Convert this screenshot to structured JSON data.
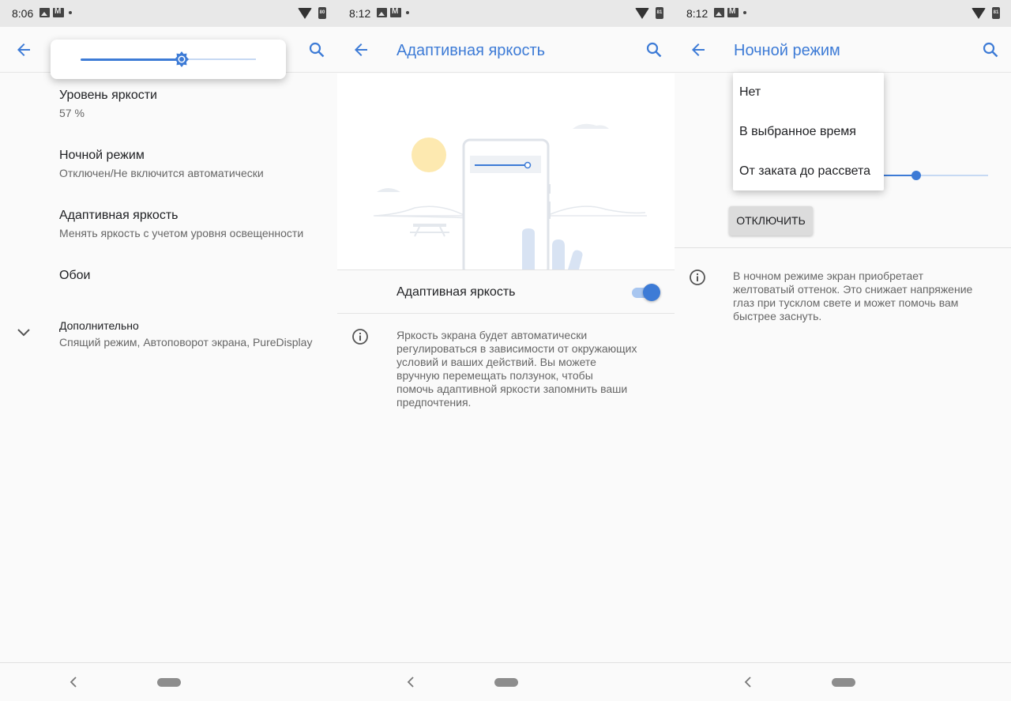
{
  "screen1": {
    "status": {
      "time": "8:06",
      "battery": "80"
    },
    "brightness_popup": {
      "level": 0.57
    },
    "items": [
      {
        "title": "Уровень яркости",
        "subtitle": "57 %"
      },
      {
        "title": "Ночной режим",
        "subtitle": "Отключен/Не включится автоматически"
      },
      {
        "title": "Адаптивная яркость",
        "subtitle": "Менять яркость с учетом уровня освещенности"
      },
      {
        "title": "Обои",
        "subtitle": ""
      },
      {
        "title": "Дополнительно",
        "subtitle": "Спящий режим, Автоповорот экрана, PureDisplay"
      }
    ]
  },
  "screen2": {
    "status": {
      "time": "8:12",
      "battery": "81"
    },
    "title": "Адаптивная яркость",
    "toggle_label": "Адаптивная яркость",
    "toggle_on": true,
    "info": "Яркость экрана будет автоматически регулироваться в зависимости от окружающих условий и ваших действий. Вы можете вручную перемещать ползунок, чтобы помочь адаптивной яркости запомнить ваши предпочтения.",
    "info_lines": [
      "Яркость экрана будет автоматически",
      "регулироваться в зависимости от окружающих",
      "условий и ваших действий. Вы можете",
      "вручную перемещать ползунок, чтобы",
      "помочь адаптивной яркости запомнить ваши",
      "предпочтения."
    ]
  },
  "screen3": {
    "status": {
      "time": "8:12",
      "battery": "81"
    },
    "title": "Ночной режим",
    "menu": [
      "Нет",
      "В выбранное время",
      "От заката до рассвета"
    ],
    "button_label": "ОТКЛЮЧИТЬ",
    "info_lines": [
      "В ночном режиме экран приобретает",
      "желтоватый оттенок. Это снижает напряжение",
      "глаз при тусклом свете и может помочь вам",
      "быстрее заснуть."
    ]
  },
  "colors": {
    "accent": "#3d7bd6",
    "background": "#fafafa",
    "statusbar": "#e8e8e8"
  }
}
